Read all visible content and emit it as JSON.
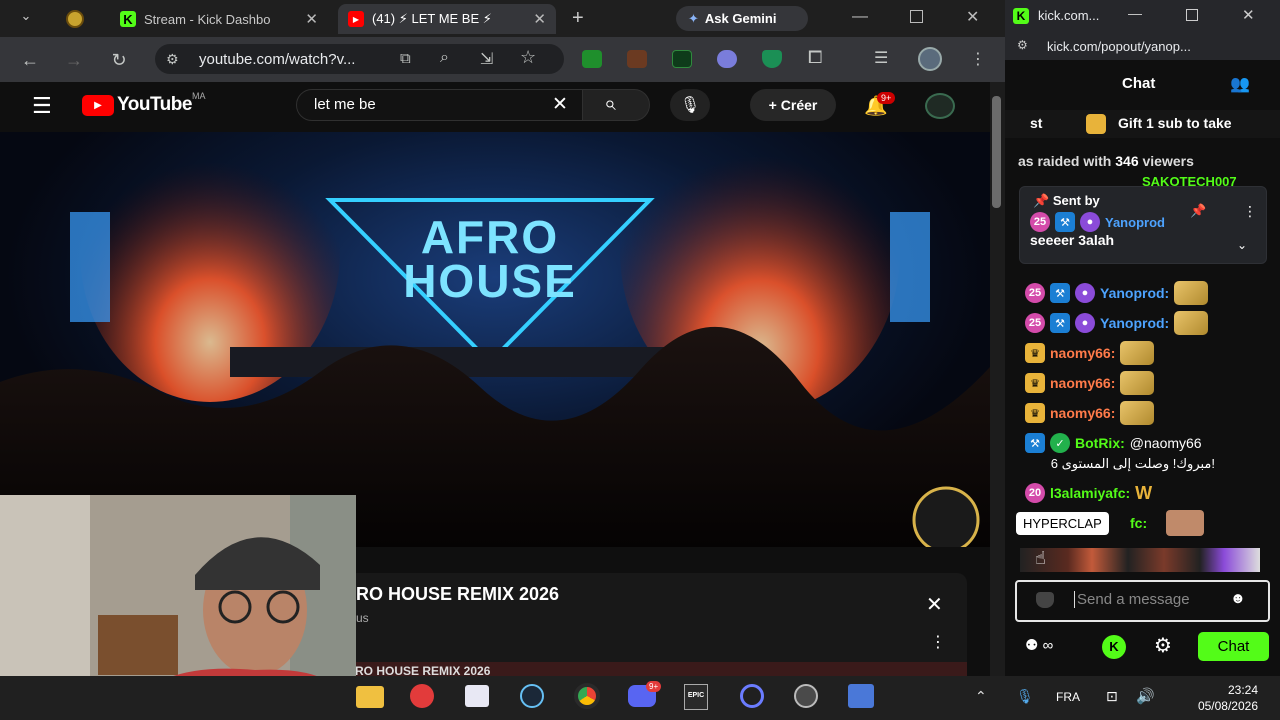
{
  "browser": {
    "tabs": [
      {
        "label": "Stream - Kick Dashbo"
      },
      {
        "label": "(41) ⚡ LET ME BE ⚡"
      }
    ],
    "gemini_label": "Ask Gemini",
    "url": "youtube.com/watch?v..."
  },
  "youtube": {
    "logo": "YouTube",
    "region": "MA",
    "search_value": "let me be",
    "create_label": "Créer",
    "notif_count": "9+",
    "video_title": "RO HOUSE REMIX 2026",
    "video_subtitle": "us",
    "next_title": "RO HOUSE REMIX 2026",
    "overlay_line1": "AFRO",
    "overlay_line2": "HOUSE"
  },
  "taskbar": {
    "lang": "FRA",
    "time": "23:24",
    "date": "05/08/2026",
    "discord_badge": "9+"
  },
  "chat_window": {
    "title": "kick.com...",
    "url": "kick.com/popout/yanop...",
    "header": "Chat",
    "gift_prefix": "st",
    "gift_text": "Gift 1 sub to take",
    "raid_text_a": "as raided with ",
    "raid_count": "346",
    "raid_text_b": " viewers",
    "hidden_user": "SAKOTECH007",
    "pinned": {
      "sent_by": "Sent by",
      "user": "Yanoprod",
      "message": "seeeer 3alah"
    },
    "messages": [
      {
        "user": "Yanoprod:",
        "color": "#4da3ff",
        "badge": "25"
      },
      {
        "user": "Yanoprod:",
        "color": "#4da3ff",
        "badge": "25"
      },
      {
        "user": "naomy66:",
        "color": "#ff7b4a",
        "badge": "crown"
      },
      {
        "user": "naomy66:",
        "color": "#ff7b4a",
        "badge": "crown"
      },
      {
        "user": "naomy66:",
        "color": "#ff7b4a",
        "badge": "crown"
      }
    ],
    "botrix": {
      "user": "BotRix:",
      "mention": "@naomy66",
      "text": "!مبروك! وصلت إلى المستوى 6"
    },
    "l3alamiya": {
      "user": "l3alamiyafc:",
      "badge": "20",
      "emote_text": "W"
    },
    "tooltip": "HYPERCLAP",
    "partial_user": "fc:",
    "input_placeholder": "Send a message",
    "send_label": "Chat"
  }
}
